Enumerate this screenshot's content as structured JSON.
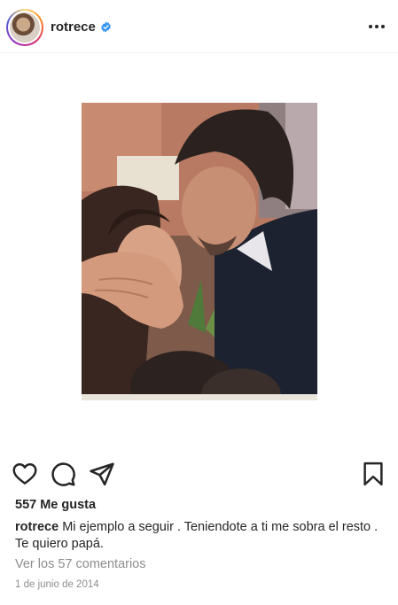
{
  "header": {
    "username": "rotrece",
    "verified": true,
    "avatar_icon": "profile-avatar",
    "more_icon": "more-horizontal-icon"
  },
  "post": {
    "image_description": "photo",
    "photo_border_color": "#e9e4dc"
  },
  "actions": {
    "like_icon": "heart-icon",
    "comment_icon": "comment-icon",
    "share_icon": "send-icon",
    "save_icon": "bookmark-icon"
  },
  "likes_text": "557 Me gusta",
  "caption": {
    "username": "rotrece",
    "text": " Mi ejemplo a seguir . Teniendote a ti me sobra el resto . Te quiero papá."
  },
  "comments_link": "Ver los 57 comentarios",
  "date": "1 de junio de 2014",
  "colors": {
    "text": "#262626",
    "muted": "#8e8e8e",
    "verified_blue": "#3897f0"
  }
}
